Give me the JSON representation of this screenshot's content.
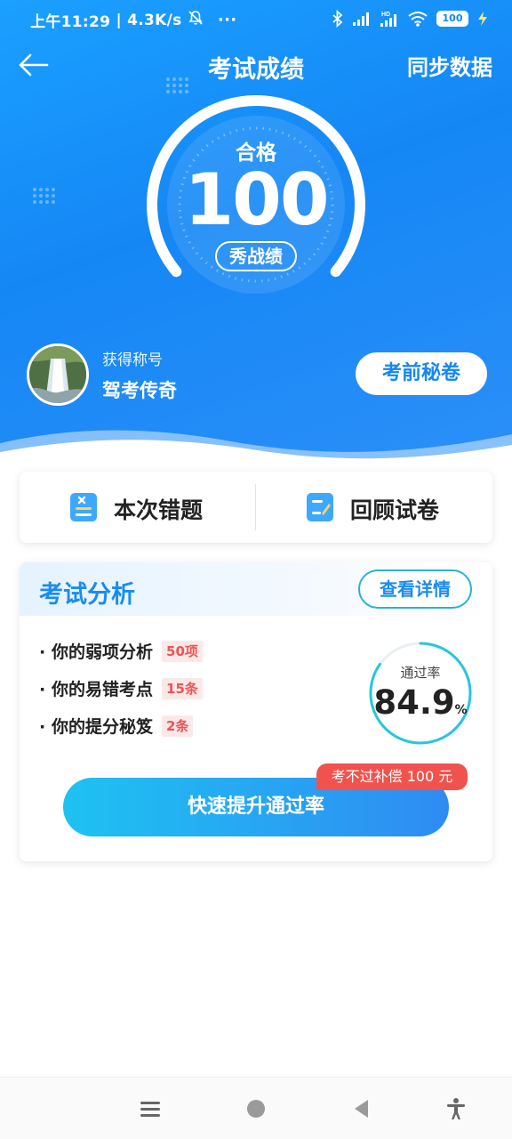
{
  "status_bar": {
    "time": "上午11:29",
    "speed": "4.3K/s",
    "more": "···",
    "hd_label": "HD",
    "battery": "100"
  },
  "nav": {
    "title": "考试成绩",
    "sync_label": "同步数据"
  },
  "score": {
    "status": "合格",
    "value": "100",
    "progress": 1.0,
    "share_label": "秀战绩"
  },
  "profile": {
    "caption": "获得称号",
    "title": "驾考传奇",
    "secret_button": "考前秘卷"
  },
  "actions": [
    {
      "label": "本次错题",
      "icon": "wrong-questions-icon"
    },
    {
      "label": "回顾试卷",
      "icon": "review-paper-icon"
    }
  ],
  "analysis": {
    "title": "考试分析",
    "detail_button": "查看详情",
    "items": [
      {
        "text": "你的弱项分析",
        "tag": "50项"
      },
      {
        "text": "你的易错考点",
        "tag": "15条"
      },
      {
        "text": "你的提分秘笈",
        "tag": "2条"
      }
    ],
    "pass_rate": {
      "caption": "通过率",
      "value": "84.9",
      "unit": "%",
      "fraction": 0.849
    },
    "boost_button": "快速提升通过率",
    "compensation_badge": "考不过补偿 100 元"
  },
  "colors": {
    "primary": "#1587f5",
    "accent_cyan": "#27b3d6",
    "tag_red": "#f05252",
    "badge_red": "#f0534e"
  }
}
